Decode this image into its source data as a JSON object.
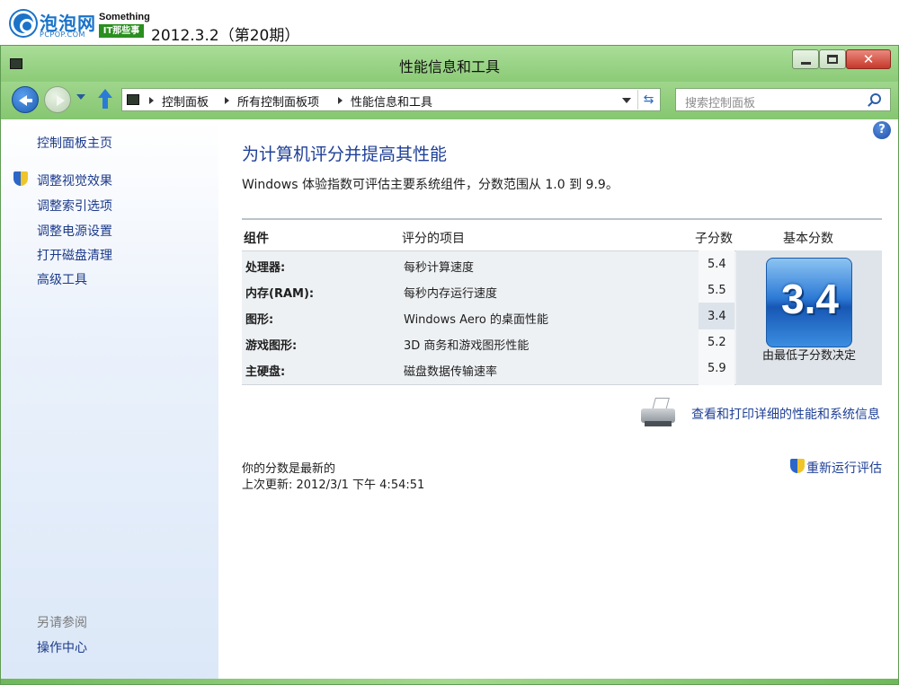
{
  "banner": {
    "logo_name": "泡泡网",
    "logo_sub": "PCPOP.COM",
    "something": "Something",
    "it_tag": "IT那些事",
    "issue": "2012.3.2（第20期）"
  },
  "window": {
    "title": "性能信息和工具",
    "close_glyph": "✕"
  },
  "address": {
    "crumbs": [
      "控制面板",
      "所有控制面板项",
      "性能信息和工具"
    ],
    "refresh_glyph": "⇆"
  },
  "search": {
    "placeholder": "搜索控制面板"
  },
  "sidebar": {
    "home": "控制面板主页",
    "links": [
      "调整视觉效果",
      "调整索引选项",
      "调整电源设置",
      "打开磁盘清理",
      "高级工具"
    ],
    "see_also": "另请参阅",
    "action_center": "操作中心"
  },
  "main": {
    "help_glyph": "?",
    "heading": "为计算机评分并提高其性能",
    "description": "Windows 体验指数可评估主要系统组件，分数范围从 1.0 到 9.9。",
    "headers": {
      "component": "组件",
      "rated": "评分的项目",
      "subscore": "子分数",
      "base": "基本分数"
    },
    "rows": [
      {
        "component": "处理器:",
        "rated": "每秒计算速度",
        "score": "5.4"
      },
      {
        "component": "内存(RAM):",
        "rated": "每秒内存运行速度",
        "score": "5.5"
      },
      {
        "component": "图形:",
        "rated": "Windows Aero 的桌面性能",
        "score": "3.4"
      },
      {
        "component": "游戏图形:",
        "rated": "3D 商务和游戏图形性能",
        "score": "5.2"
      },
      {
        "component": "主硬盘:",
        "rated": "磁盘数据传输速率",
        "score": "5.9"
      }
    ],
    "base_score": "3.4",
    "base_caption": "由最低子分数决定",
    "print_link": "查看和打印详细的性能和系统信息",
    "status_current": "你的分数是最新的",
    "status_updated": "上次更新: 2012/3/1 下午 4:54:51",
    "rerun_link": "重新运行评估"
  },
  "colors": {
    "window_green": "#8ecf7b",
    "link_blue": "#1e3f96",
    "sidebar_link": "#1c3a8a"
  },
  "icons": [
    "logo-icon",
    "control-panel-icon",
    "back-arrow-icon",
    "forward-arrow-icon",
    "up-arrow-icon",
    "search-icon",
    "help-icon",
    "shield-icon",
    "printer-icon"
  ]
}
